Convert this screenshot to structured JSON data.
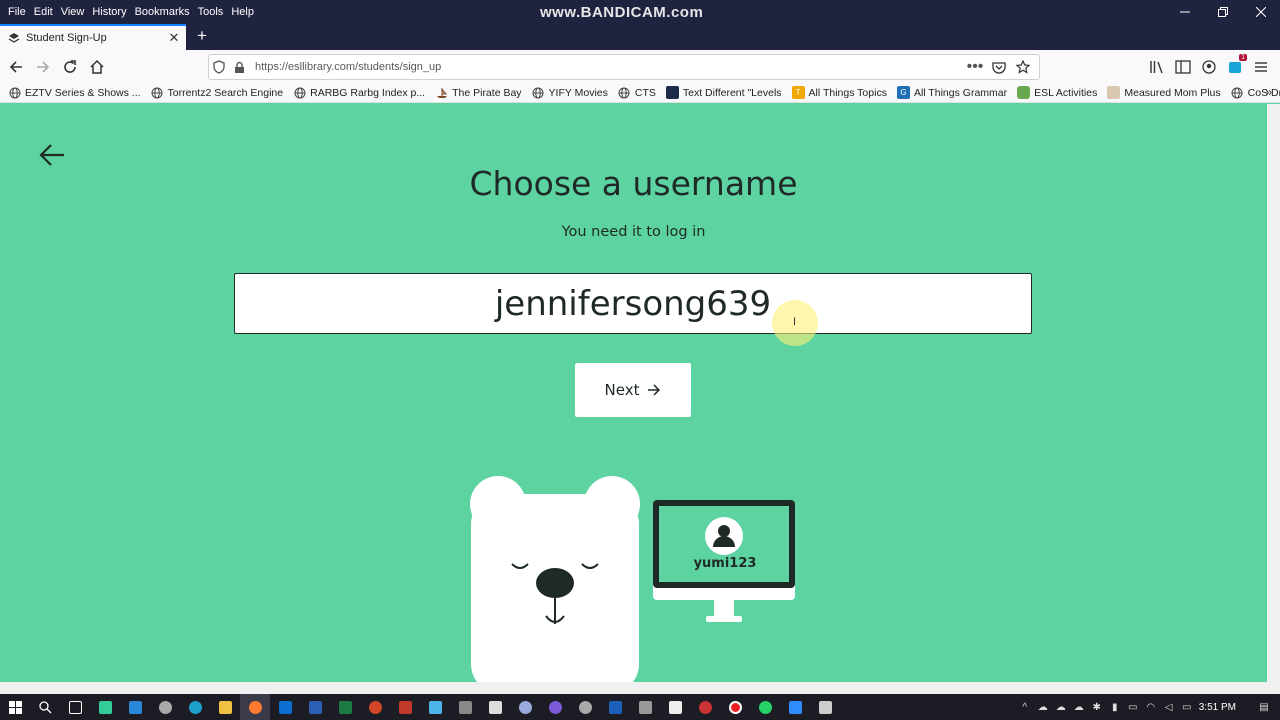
{
  "window": {
    "menu": [
      "File",
      "Edit",
      "View",
      "History",
      "Bookmarks",
      "Tools",
      "Help"
    ],
    "watermark": "www.BANDICAM.com"
  },
  "tab": {
    "title": "Student Sign-Up"
  },
  "url": "https://esllibrary.com/students/sign_up",
  "bookmarks": [
    {
      "label": "EZTV Series & Shows ...",
      "icon": "globe-icon"
    },
    {
      "label": "Torrentz2 Search Engine",
      "icon": "globe-icon"
    },
    {
      "label": "RARBG Rarbg Index p...",
      "icon": "globe-icon"
    },
    {
      "label": "The Pirate Bay",
      "icon": "ship-icon"
    },
    {
      "label": "YIFY Movies",
      "icon": "globe-icon"
    },
    {
      "label": "CTS",
      "icon": "globe-icon"
    },
    {
      "label": "Text Different \"Levels",
      "icon": "app-icon"
    },
    {
      "label": "All Things Topics",
      "icon": "t-icon"
    },
    {
      "label": "All Things Grammar",
      "icon": "g-icon"
    },
    {
      "label": "ESL Activities",
      "icon": "leaf-icon"
    },
    {
      "label": "Measured Mom Plus",
      "icon": "book-icon"
    },
    {
      "label": "CoS Drop-In",
      "icon": "globe-icon"
    }
  ],
  "page": {
    "heading": "Choose a username",
    "subheading": "You need it to log in",
    "username_value": "jennifersong639",
    "next_label": "Next",
    "monitor_username": "yumi123"
  },
  "colors": {
    "page_bg": "#5cd3a1",
    "text": "#1f2a26",
    "titlebar": "#202340"
  },
  "taskbar": {
    "time": "3:51 PM"
  }
}
